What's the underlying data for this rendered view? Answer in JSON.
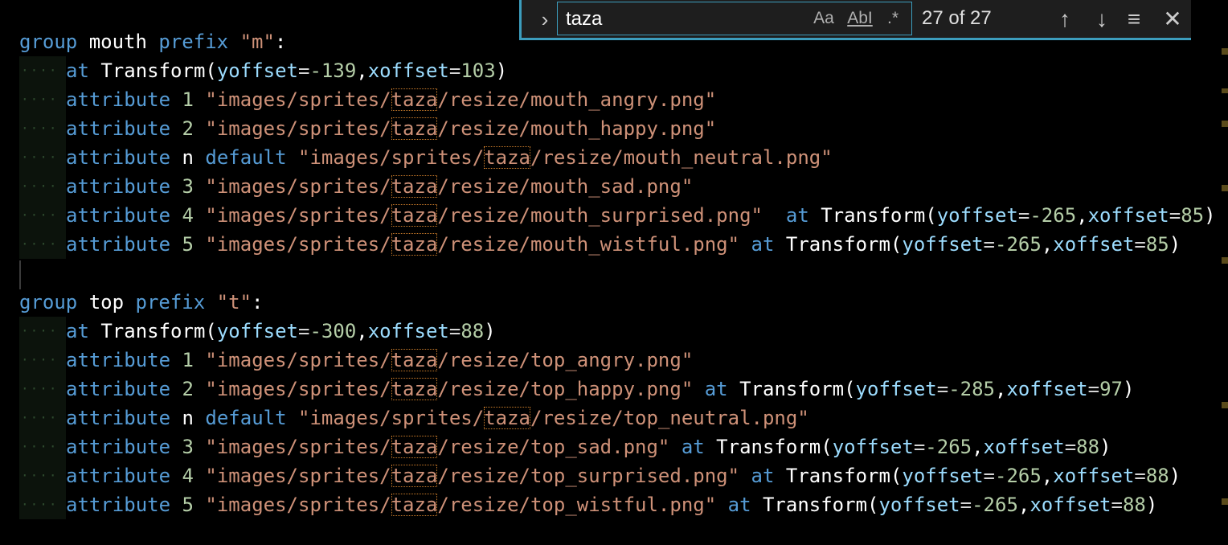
{
  "find": {
    "query": "taza",
    "match_case_label": "Aa",
    "whole_word_label": "AbI",
    "regex_label": ".*",
    "count": "27 of 27",
    "prev_icon": "arrow-up",
    "next_icon": "arrow-down",
    "selection_icon": "find-in-selection",
    "close_icon": "close",
    "toggle_icon": "chevron-right"
  },
  "colors": {
    "keyword": "#569cd6",
    "string": "#ce9178",
    "number": "#b5cea8",
    "parameter": "#9cdcfe",
    "highlight_border": "#c77a2a",
    "accent": "#3c9dbd"
  },
  "code": {
    "lines": [
      {
        "indent": 0,
        "tokens": [
          [
            "kw",
            "group"
          ],
          [
            "id",
            " mouth "
          ],
          [
            "kw",
            "prefix"
          ],
          [
            "id",
            " "
          ],
          [
            "str",
            "\"m\""
          ],
          [
            "id",
            ":"
          ]
        ]
      },
      {
        "indent": 1,
        "tokens": [
          [
            "kw",
            "at"
          ],
          [
            "id",
            " Transform("
          ],
          [
            "prm",
            "yoffset"
          ],
          [
            "pn",
            "="
          ],
          [
            "num",
            "-139"
          ],
          [
            "id",
            ","
          ],
          [
            "prm",
            "xoffset"
          ],
          [
            "pn",
            "="
          ],
          [
            "num",
            "103"
          ],
          [
            "id",
            ")"
          ]
        ]
      },
      {
        "indent": 1,
        "tokens": [
          [
            "kw",
            "attribute"
          ],
          [
            "id",
            " "
          ],
          [
            "num",
            "1"
          ],
          [
            "id",
            " "
          ],
          [
            "str",
            "\"images/sprites/"
          ],
          [
            "hl",
            "taza"
          ],
          [
            "str",
            "/resize/mouth_angry.png\""
          ]
        ]
      },
      {
        "indent": 1,
        "tokens": [
          [
            "kw",
            "attribute"
          ],
          [
            "id",
            " "
          ],
          [
            "num",
            "2"
          ],
          [
            "id",
            " "
          ],
          [
            "str",
            "\"images/sprites/"
          ],
          [
            "hl",
            "taza"
          ],
          [
            "str",
            "/resize/mouth_happy.png\""
          ]
        ]
      },
      {
        "indent": 1,
        "tokens": [
          [
            "kw",
            "attribute"
          ],
          [
            "id",
            " n "
          ],
          [
            "kw",
            "default"
          ],
          [
            "id",
            " "
          ],
          [
            "str",
            "\"images/sprites/"
          ],
          [
            "hl",
            "taza"
          ],
          [
            "str",
            "/resize/mouth_neutral.png\""
          ]
        ]
      },
      {
        "indent": 1,
        "tokens": [
          [
            "kw",
            "attribute"
          ],
          [
            "id",
            " "
          ],
          [
            "num",
            "3"
          ],
          [
            "id",
            " "
          ],
          [
            "str",
            "\"images/sprites/"
          ],
          [
            "hl",
            "taza"
          ],
          [
            "str",
            "/resize/mouth_sad.png\""
          ]
        ]
      },
      {
        "indent": 1,
        "tokens": [
          [
            "kw",
            "attribute"
          ],
          [
            "id",
            " "
          ],
          [
            "num",
            "4"
          ],
          [
            "id",
            " "
          ],
          [
            "str",
            "\"images/sprites/"
          ],
          [
            "hl",
            "taza"
          ],
          [
            "str",
            "/resize/mouth_surprised.png\""
          ],
          [
            "id",
            "  "
          ],
          [
            "kw",
            "at"
          ],
          [
            "id",
            " Transform("
          ],
          [
            "prm",
            "yoffset"
          ],
          [
            "pn",
            "="
          ],
          [
            "num",
            "-265"
          ],
          [
            "id",
            ","
          ],
          [
            "prm",
            "xoffset"
          ],
          [
            "pn",
            "="
          ],
          [
            "num",
            "85"
          ],
          [
            "id",
            ")"
          ]
        ]
      },
      {
        "indent": 1,
        "tokens": [
          [
            "kw",
            "attribute"
          ],
          [
            "id",
            " "
          ],
          [
            "num",
            "5"
          ],
          [
            "id",
            " "
          ],
          [
            "str",
            "\"images/sprites/"
          ],
          [
            "hl",
            "taza"
          ],
          [
            "str",
            "/resize/mouth_wistful.png\""
          ],
          [
            "id",
            " "
          ],
          [
            "kw",
            "at"
          ],
          [
            "id",
            " Transform("
          ],
          [
            "prm",
            "yoffset"
          ],
          [
            "pn",
            "="
          ],
          [
            "num",
            "-265"
          ],
          [
            "id",
            ","
          ],
          [
            "prm",
            "xoffset"
          ],
          [
            "pn",
            "="
          ],
          [
            "num",
            "85"
          ],
          [
            "id",
            ")"
          ]
        ]
      },
      {
        "indent": 0,
        "tokens": []
      },
      {
        "indent": 0,
        "tokens": [
          [
            "kw",
            "group"
          ],
          [
            "id",
            " top "
          ],
          [
            "kw",
            "prefix"
          ],
          [
            "id",
            " "
          ],
          [
            "str",
            "\"t\""
          ],
          [
            "id",
            ":"
          ]
        ]
      },
      {
        "indent": 1,
        "tokens": [
          [
            "kw",
            "at"
          ],
          [
            "id",
            " Transform("
          ],
          [
            "prm",
            "yoffset"
          ],
          [
            "pn",
            "="
          ],
          [
            "num",
            "-300"
          ],
          [
            "id",
            ","
          ],
          [
            "prm",
            "xoffset"
          ],
          [
            "pn",
            "="
          ],
          [
            "num",
            "88"
          ],
          [
            "id",
            ")"
          ]
        ]
      },
      {
        "indent": 1,
        "tokens": [
          [
            "kw",
            "attribute"
          ],
          [
            "id",
            " "
          ],
          [
            "num",
            "1"
          ],
          [
            "id",
            " "
          ],
          [
            "str",
            "\"images/sprites/"
          ],
          [
            "hl",
            "taza"
          ],
          [
            "str",
            "/resize/top_angry.png\""
          ]
        ]
      },
      {
        "indent": 1,
        "tokens": [
          [
            "kw",
            "attribute"
          ],
          [
            "id",
            " "
          ],
          [
            "num",
            "2"
          ],
          [
            "id",
            " "
          ],
          [
            "str",
            "\"images/sprites/"
          ],
          [
            "hl",
            "taza"
          ],
          [
            "str",
            "/resize/top_happy.png\""
          ],
          [
            "id",
            " "
          ],
          [
            "kw",
            "at"
          ],
          [
            "id",
            " Transform("
          ],
          [
            "prm",
            "yoffset"
          ],
          [
            "pn",
            "="
          ],
          [
            "num",
            "-285"
          ],
          [
            "id",
            ","
          ],
          [
            "prm",
            "xoffset"
          ],
          [
            "pn",
            "="
          ],
          [
            "num",
            "97"
          ],
          [
            "id",
            ")"
          ]
        ]
      },
      {
        "indent": 1,
        "tokens": [
          [
            "kw",
            "attribute"
          ],
          [
            "id",
            " n "
          ],
          [
            "kw",
            "default"
          ],
          [
            "id",
            " "
          ],
          [
            "str",
            "\"images/sprites/"
          ],
          [
            "hl",
            "taza"
          ],
          [
            "str",
            "/resize/top_neutral.png\""
          ]
        ]
      },
      {
        "indent": 1,
        "tokens": [
          [
            "kw",
            "attribute"
          ],
          [
            "id",
            " "
          ],
          [
            "num",
            "3"
          ],
          [
            "id",
            " "
          ],
          [
            "str",
            "\"images/sprites/"
          ],
          [
            "hl",
            "taza"
          ],
          [
            "str",
            "/resize/top_sad.png\""
          ],
          [
            "id",
            " "
          ],
          [
            "kw",
            "at"
          ],
          [
            "id",
            " Transform("
          ],
          [
            "prm",
            "yoffset"
          ],
          [
            "pn",
            "="
          ],
          [
            "num",
            "-265"
          ],
          [
            "id",
            ","
          ],
          [
            "prm",
            "xoffset"
          ],
          [
            "pn",
            "="
          ],
          [
            "num",
            "88"
          ],
          [
            "id",
            ")"
          ]
        ]
      },
      {
        "indent": 1,
        "tokens": [
          [
            "kw",
            "attribute"
          ],
          [
            "id",
            " "
          ],
          [
            "num",
            "4"
          ],
          [
            "id",
            " "
          ],
          [
            "str",
            "\"images/sprites/"
          ],
          [
            "hl",
            "taza"
          ],
          [
            "str",
            "/resize/top_surprised.png\""
          ],
          [
            "id",
            " "
          ],
          [
            "kw",
            "at"
          ],
          [
            "id",
            " Transform("
          ],
          [
            "prm",
            "yoffset"
          ],
          [
            "pn",
            "="
          ],
          [
            "num",
            "-265"
          ],
          [
            "id",
            ","
          ],
          [
            "prm",
            "xoffset"
          ],
          [
            "pn",
            "="
          ],
          [
            "num",
            "88"
          ],
          [
            "id",
            ")"
          ]
        ]
      },
      {
        "indent": 1,
        "tokens": [
          [
            "kw",
            "attribute"
          ],
          [
            "id",
            " "
          ],
          [
            "num",
            "5"
          ],
          [
            "id",
            " "
          ],
          [
            "str",
            "\"images/sprites/"
          ],
          [
            "hl",
            "taza"
          ],
          [
            "str",
            "/resize/top_wistful.png\""
          ],
          [
            "id",
            " "
          ],
          [
            "kw",
            "at"
          ],
          [
            "id",
            " Transform("
          ],
          [
            "prm",
            "yoffset"
          ],
          [
            "pn",
            "="
          ],
          [
            "num",
            "-265"
          ],
          [
            "id",
            ","
          ],
          [
            "prm",
            "xoffset"
          ],
          [
            "pn",
            "="
          ],
          [
            "num",
            "88"
          ],
          [
            "id",
            ")"
          ]
        ]
      }
    ]
  }
}
